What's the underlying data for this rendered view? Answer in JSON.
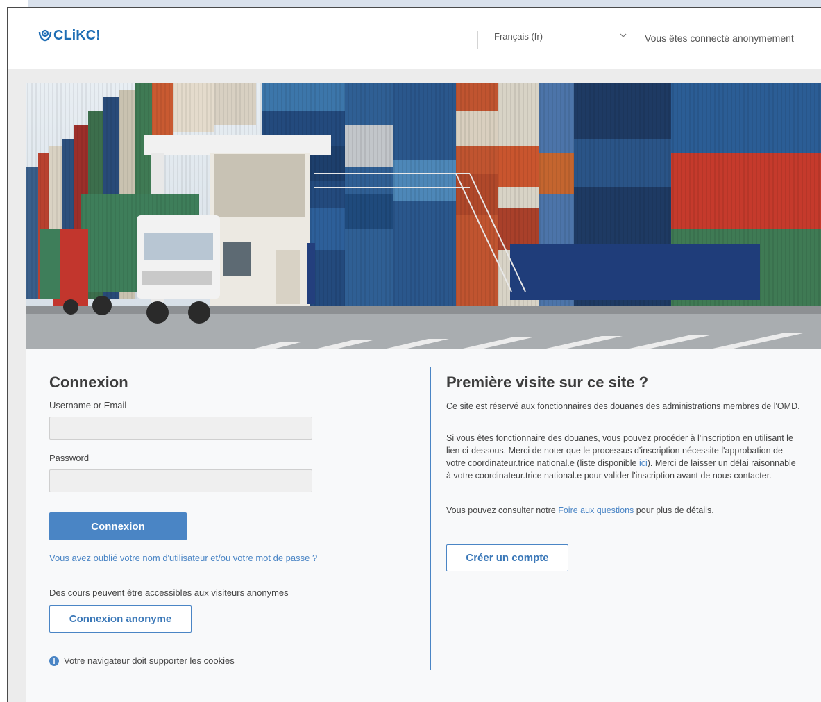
{
  "header": {
    "logo_text": "CLiKC!",
    "language_selected": "Français (fr)",
    "login_status": "Vous êtes connecté anonymement"
  },
  "login": {
    "title": "Connexion",
    "username_label": "Username or Email",
    "username_value": "",
    "password_label": "Password",
    "password_value": "",
    "submit_label": "Connexion",
    "forgot_link": "Vous avez oublié votre nom d'utilisateur et/ou votre mot de passe ?",
    "anon_note": "Des cours peuvent être accessibles aux visiteurs anonymes",
    "anon_button": "Connexion anonyme",
    "cookie_note": "Votre navigateur doit supporter les cookies"
  },
  "signup": {
    "title": "Première visite sur ce site ?",
    "para1": "Ce site est réservé aux fonctionnaires des douanes des administrations membres de l'OMD.",
    "para2_before": "Si vous êtes fonctionnaire des douanes, vous pouvez procéder à l'inscription en utilisant le lien ci-dessous. Merci de noter que le processus d'inscription nécessite l'approbation de votre coordinateur.trice national.e (liste disponible ",
    "para2_link": "ici",
    "para2_after": "). Merci de laisser un délai raisonnable à votre coordinateur.trice national.e pour valider l'inscription avant de nous contacter.",
    "para3_before": "Vous pouvez consulter notre ",
    "para3_link": "Foire aux questions",
    "para3_after": " pour plus de détails.",
    "create_button": "Créer un compte"
  },
  "colors": {
    "accent": "#4a85c5",
    "logo": "#1e6db4",
    "header_bg": "#ffffff",
    "page_bg": "#ececec",
    "panel_bg": "#f8f9fa"
  },
  "icons": {
    "logo": "clikc-logo-icon",
    "language_dropdown": "chevron-down-icon",
    "cookie_info": "info-icon"
  }
}
